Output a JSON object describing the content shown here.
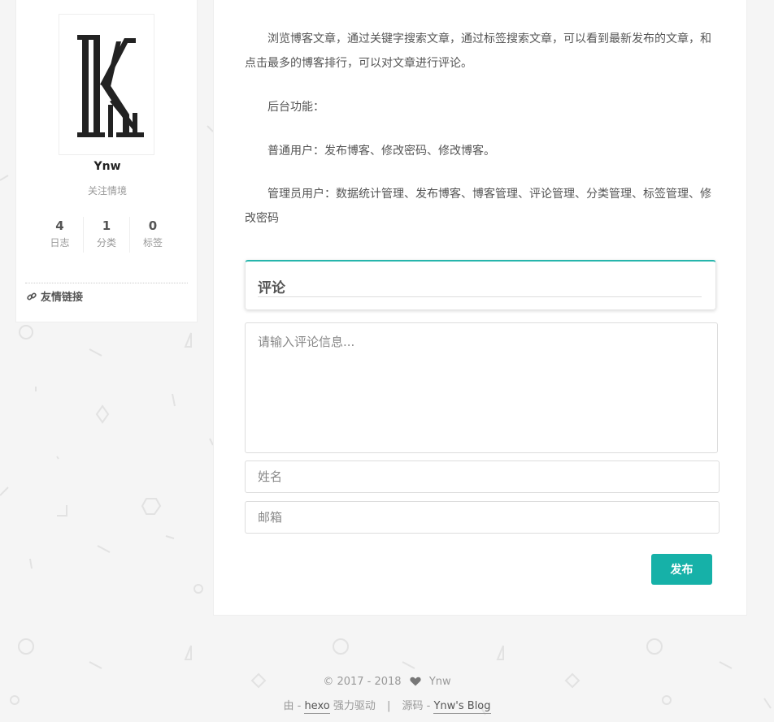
{
  "sidebar": {
    "author_name": "Ynw",
    "author_desc": "关注情境",
    "stats": [
      {
        "count": "4",
        "label": "日志"
      },
      {
        "count": "1",
        "label": "分类"
      },
      {
        "count": "0",
        "label": "标签"
      }
    ],
    "links_title": "友情链接"
  },
  "post": {
    "paragraphs": [
      "浏览博客文章，通过关键字搜索文章，通过标签搜索文章，可以看到最新发布的文章，和点击最多的博客排行，可以对文章进行评论。",
      "后台功能：",
      "普通用户：发布博客、修改密码、修改博客。",
      "管理员用户：数据统计管理、发布博客、博客管理、评论管理、分类管理、标签管理、修改密码"
    ]
  },
  "comments": {
    "title": "评论",
    "textarea_placeholder": "请输入评论信息...",
    "name_placeholder": "姓名",
    "email_placeholder": "邮箱",
    "submit_label": "发布"
  },
  "footer": {
    "copyright": "© 2017 - 2018",
    "author": "Ynw",
    "powered_prefix": "由 - ",
    "powered_link": "hexo",
    "powered_suffix": " 强力驱动",
    "separator": "|",
    "source_prefix": "源码 - ",
    "source_link": "Ynw's Blog"
  },
  "colors": {
    "accent": "#16b1a8",
    "background": "#f5f5f5"
  }
}
